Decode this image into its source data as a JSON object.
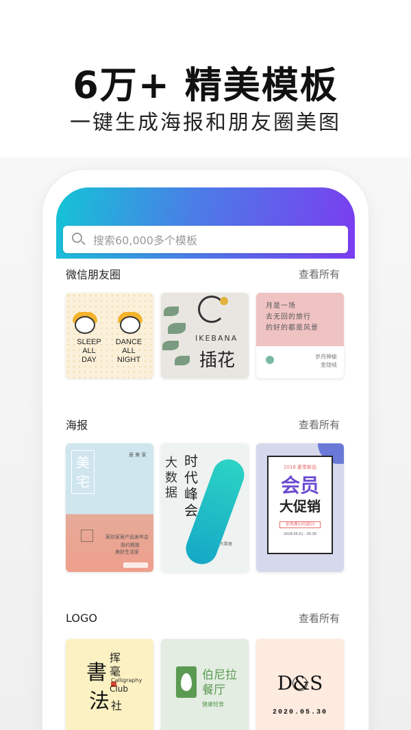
{
  "promo": {
    "title": "6万+ 精美模板",
    "subtitle": "一键生成海报和朋友圈美图"
  },
  "search": {
    "placeholder": "搜索60,000多个模板",
    "icon": "search-icon"
  },
  "sections": [
    {
      "title": "微信朋友圈",
      "see_all": "查看所有",
      "thumbs": [
        {
          "left": "SLEEP\nALL\nDAY",
          "right": "DANCE\nALL NIGHT",
          "l1": "SLEEP",
          "l2": "ALL",
          "l3": "DAY",
          "r1": "DANCE",
          "r2": "ALL NIGHT"
        },
        {
          "en": "IKEBANA",
          "cn": "插花"
        },
        {
          "v1": "月是一场",
          "v2": "去无回的旅行",
          "v3": "的好的都是风景",
          "s1": "岁月神偷",
          "s2": "金玟岐"
        }
      ]
    },
    {
      "title": "海报",
      "see_all": "查看所有",
      "thumbs": [
        {
          "big": "美宅",
          "side": "居 美 家",
          "desc1": "家纺家居产品发布会",
          "desc2": "简约精致",
          "desc3": "美好生活家"
        },
        {
          "v1": "大数据",
          "v2": "时代峰会",
          "tag": "大数据"
        },
        {
          "head": "2018 夏季新品",
          "t1": "会员",
          "t2": "大促销",
          "pill": "全场满100减50",
          "tiny": "2018.05.01 - 05.30"
        }
      ]
    },
    {
      "title": "LOGO",
      "see_all": "查看所有",
      "thumbs": [
        {
          "c1": "書",
          "c2": "法",
          "s1": "挥",
          "s2": "毫",
          "en": "Calligraphy",
          "club": "Club",
          "she": "社"
        },
        {
          "n1": "伯尼拉",
          "n2": "餐厅",
          "m": "健康轻食"
        },
        {
          "mono": "D&S",
          "date": "2020.05.30"
        }
      ]
    }
  ],
  "colors": {
    "header_gradient_start": "#14c4d6",
    "header_gradient_end": "#7b3cf0"
  }
}
